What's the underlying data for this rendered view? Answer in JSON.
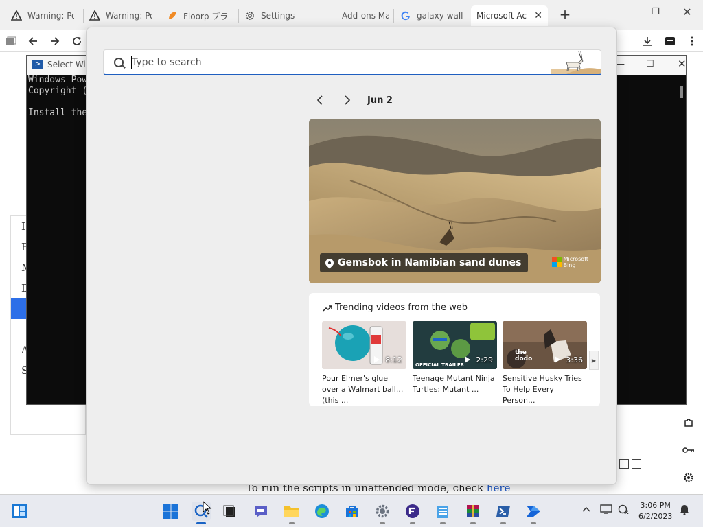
{
  "browser": {
    "tabs": [
      {
        "title": "Warning: Pot",
        "icon": "warning-icon"
      },
      {
        "title": "Warning: Pot",
        "icon": "warning-icon"
      },
      {
        "title": "Floorp ブラ",
        "icon": "floorp-icon"
      },
      {
        "title": "Settings",
        "icon": "gear-icon"
      },
      {
        "title": "Add-ons Ma",
        "icon": "puzzle-icon"
      },
      {
        "title": "galaxy wallp",
        "icon": "google-icon"
      },
      {
        "title": "Microsoft Act",
        "icon": "microsoft-icon",
        "active": true
      }
    ]
  },
  "terminal": {
    "title": "Select Win",
    "lines": [
      "Windows Pow",
      "Copyright (",
      "",
      "Install the"
    ]
  },
  "page": {
    "menu_items": [
      "I",
      "F",
      "M",
      "D",
      "",
      "",
      "A",
      "S"
    ],
    "note_text": "To run the scripts in unattended mode, check ",
    "note_link": "here"
  },
  "search": {
    "placeholder": "Type to search",
    "date": "Jun 2",
    "hero_caption": "Gemsbok in Namibian sand dunes",
    "bing_line1": "Microsoft",
    "bing_line2": "Bing",
    "trending_title": "Trending videos from the web",
    "videos": [
      {
        "duration": "8:12",
        "title": "Pour Elmer's glue over a Walmart ball...(this ..."
      },
      {
        "duration": "2:29",
        "title": "Teenage Mutant Ninja Turtles: Mutant ...",
        "thumb_text": "OFFICIAL TRAILER"
      },
      {
        "duration": "3:36",
        "title": "Sensitive Husky Tries To Help Every Person...",
        "thumb_text": "the dodo"
      }
    ]
  },
  "taskbar": {
    "time": "3:06 PM",
    "date": "6/2/2023"
  },
  "colors": {
    "accent": "#1f5fc0",
    "taskbar": "#e8eaf0"
  }
}
